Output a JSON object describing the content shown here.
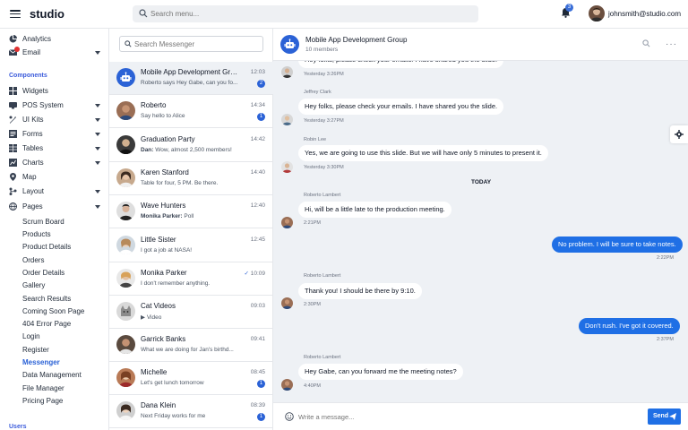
{
  "header": {
    "brand": "studio",
    "search_placeholder": "Search menu...",
    "notification_count": "3",
    "user_email": "johnsmith@studio.com"
  },
  "sidebar": {
    "analytics": "Analytics",
    "email": "Email",
    "components_heading": "Components",
    "widgets": "Widgets",
    "pos_system": "POS System",
    "ui_kits": "UI Kits",
    "forms": "Forms",
    "tables": "Tables",
    "charts": "Charts",
    "map": "Map",
    "layout": "Layout",
    "pages": "Pages",
    "sub": [
      "Scrum Board",
      "Products",
      "Product Details",
      "Orders",
      "Order Details",
      "Gallery",
      "Search Results",
      "Coming Soon Page",
      "404 Error Page",
      "Login",
      "Register",
      "Messenger",
      "Data Management",
      "File Manager",
      "Pricing Page"
    ],
    "active_sub": "Messenger",
    "users_heading": "Users"
  },
  "list": {
    "search_placeholder": "Search Messenger",
    "conversations": [
      {
        "name": "Mobile App Development Grou...",
        "prefix": "",
        "preview": "Roberto says Hey Gabe, can you fo...",
        "time": "12:03",
        "count": "2"
      },
      {
        "name": "Roberto",
        "prefix": "",
        "preview": "Say hello to Alice",
        "time": "14:34",
        "count": "1"
      },
      {
        "name": "Graduation Party",
        "prefix": "Dan:",
        "preview": " Wow, almost 2,500 members!",
        "time": "14:42",
        "count": ""
      },
      {
        "name": "Karen Stanford",
        "prefix": "",
        "preview": "Table for four, 5 PM. Be there.",
        "time": "14:40",
        "count": ""
      },
      {
        "name": "Wave Hunters",
        "prefix": "Monika Parker:",
        "preview": " Poll",
        "time": "12:40",
        "count": ""
      },
      {
        "name": "Little Sister",
        "prefix": "",
        "preview": "I got a job at NASA!",
        "time": "12:45",
        "count": ""
      },
      {
        "name": "Monika Parker",
        "prefix": "",
        "preview": "I don't remember anything.",
        "time": "10:09",
        "count": ""
      },
      {
        "name": "Cat Videos",
        "prefix": "",
        "preview": "Video",
        "time": "09:03",
        "count": ""
      },
      {
        "name": "Garrick Banks",
        "prefix": "",
        "preview": "What we are doing for Jan's birthd...",
        "time": "09:41",
        "count": ""
      },
      {
        "name": "Michelle",
        "prefix": "",
        "preview": "Let's get lunch tomorrow",
        "time": "08:45",
        "count": "1"
      },
      {
        "name": "Dana Klein",
        "prefix": "",
        "preview": "Next Friday works for me",
        "time": "08:39",
        "count": "1"
      }
    ]
  },
  "chat": {
    "title": "Mobile App Development Group",
    "members": "10 members",
    "today_label": "TODAY",
    "messages": [
      {
        "sender": "",
        "text": "Hey folks, please check your emails. I have shared you the slide.",
        "time": "Yesterday 3:26PM"
      },
      {
        "sender": "Jeffrey Clark",
        "text": "Hey folks, please check your emails. I have shared you the slide.",
        "time": "Yesterday 3:27PM"
      },
      {
        "sender": "Robin Lee",
        "text": "Yes, we are going to use this slide. But we will have only 5 minutes to present it.",
        "time": "Yesterday 3:30PM"
      },
      {
        "sender": "Roberto Lambert",
        "text": "Hi, will be a little late to the production meeting.",
        "time": "2:21PM"
      },
      {
        "sender": "",
        "text": "No problem. I will be sure to take notes.",
        "time": "2:22PM"
      },
      {
        "sender": "Roberto Lambert",
        "text": "Thank you! I should be there by 9:10.",
        "time": "2:30PM"
      },
      {
        "sender": "",
        "text": "Don't rush. I've got it covered.",
        "time": "2:37PM"
      },
      {
        "sender": "Roberto Lambert",
        "text": "Hey Gabe, can you forward me the meeting notes?",
        "time": "4:40PM"
      }
    ],
    "composer_placeholder": "Write a message...",
    "send_label": "Send"
  }
}
